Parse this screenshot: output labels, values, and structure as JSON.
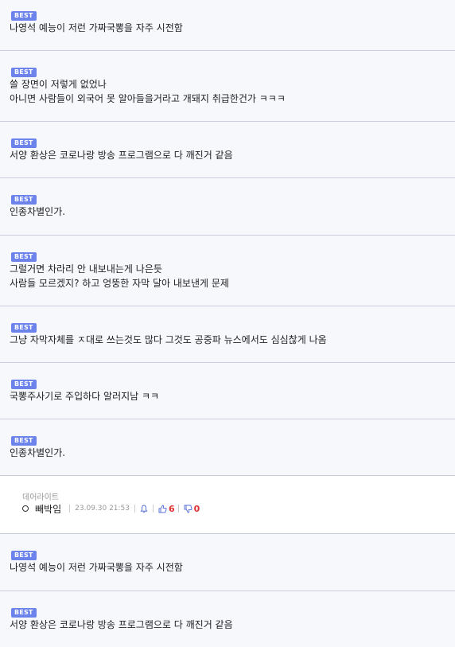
{
  "badge_label": "BEST",
  "best_items_top": [
    {
      "lines": [
        "나영석 예능이 저런 가짜국뽕을 자주 시전함"
      ]
    },
    {
      "lines": [
        "쓸 장면이 저렇게 없었나",
        "아니면 사람들이 외국어 못 알아들을거라고 개돼지 취급한건가 ㅋㅋㅋ"
      ]
    },
    {
      "lines": [
        "서양 환상은 코로나랑 방송 프로그램으로 다 깨진거 같음"
      ]
    },
    {
      "lines": [
        "인종차별인가."
      ]
    },
    {
      "lines": [
        "그럴거면 차라리 안 내보내는게 나은듯",
        "사람들 모르겠지? 하고 엉뚱한 자막 달아 내보낸게 문제"
      ]
    },
    {
      "lines": [
        "그냥 자막자체를 ㅈ대로 쓰는것도 많다 그것도 공중파 뉴스에서도 심심찮게 나옴"
      ]
    },
    {
      "lines": [
        "국뽕주사기로 주입하다 알러지남 ㅋㅋ"
      ]
    },
    {
      "lines": [
        "인종차별인가."
      ]
    }
  ],
  "comment": {
    "author_label": "데어라이트",
    "nickname": "빼박임",
    "date": "23.09.30 21:53",
    "upvotes": "6",
    "downvotes": "0"
  },
  "best_items_bottom": [
    {
      "lines": [
        "나영석 예능이 저런 가짜국뽕을 자주 시전함"
      ]
    },
    {
      "lines": [
        "서양 환상은 코로나랑 방송 프로그램으로 다 깨진거 같음"
      ]
    }
  ],
  "colors": {
    "badge_bg": "#6b83ea",
    "best_bg": "#f7f8fc",
    "divider": "#c9cdd9",
    "vote": "#e03131",
    "icon_blue": "#5b73d9"
  },
  "icons": {
    "bell": "bell-icon",
    "thumb_up": "thumbs-up-icon",
    "thumb_down": "thumbs-down-icon"
  }
}
